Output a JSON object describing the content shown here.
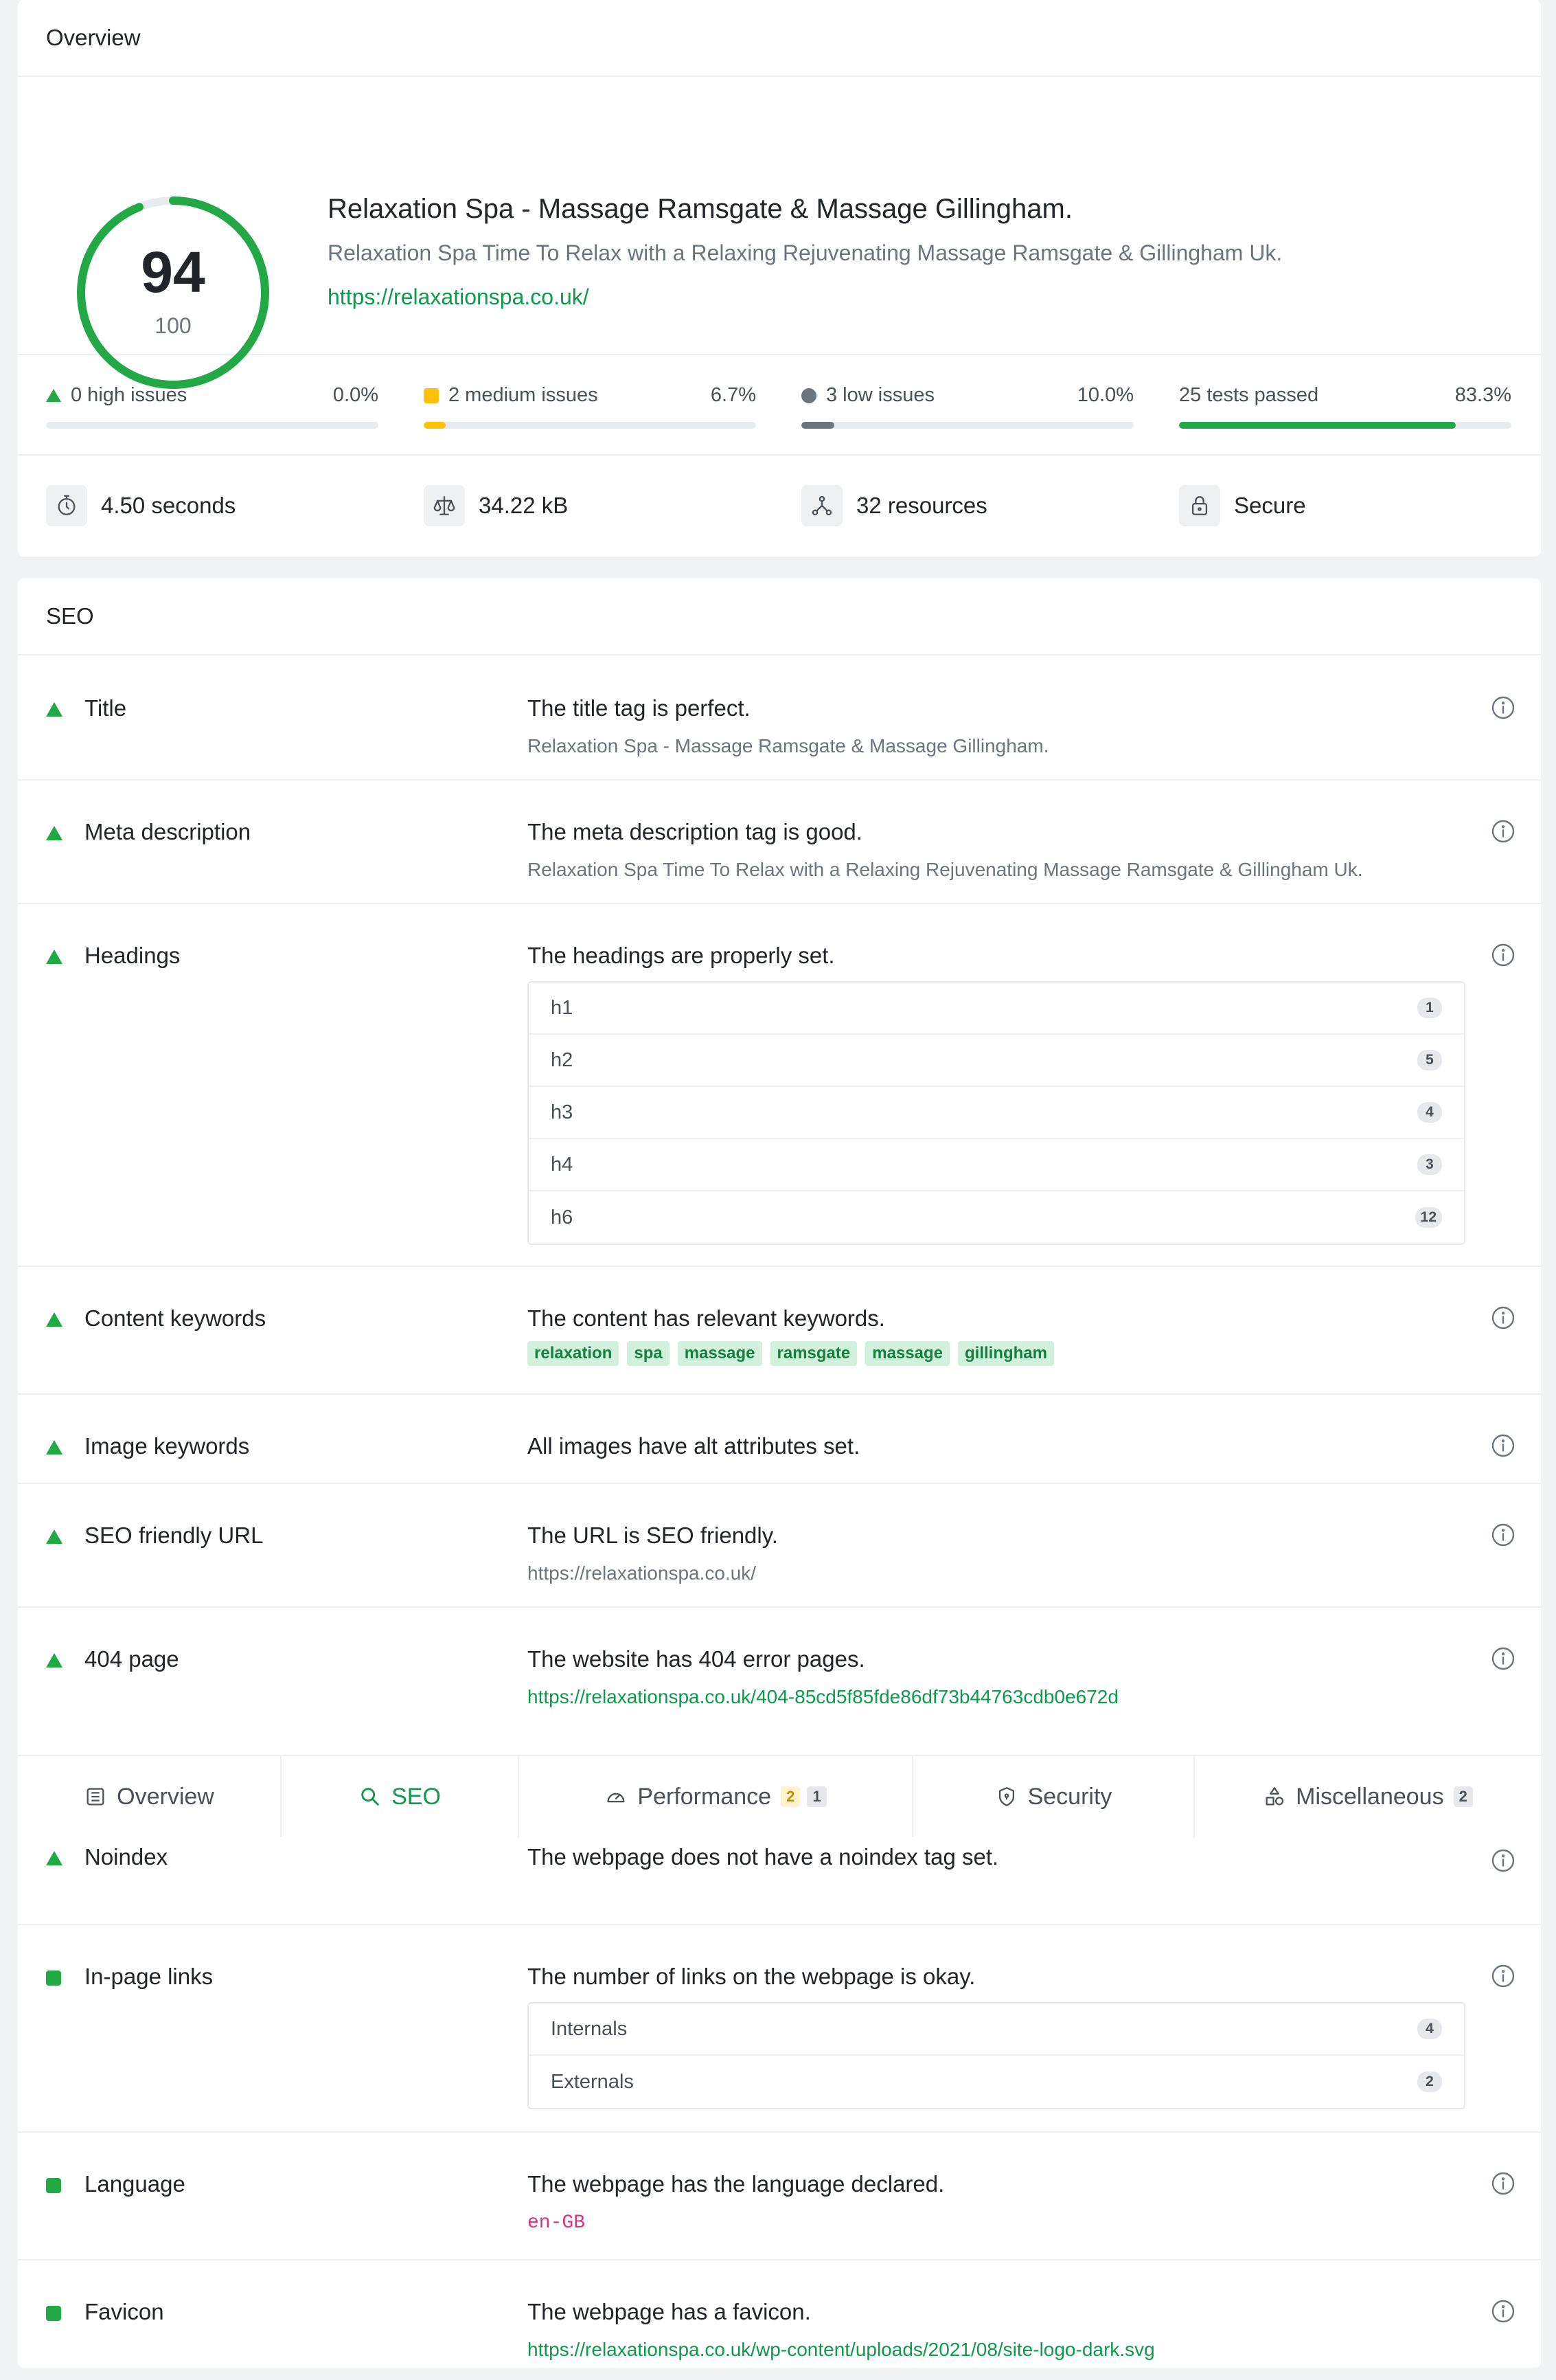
{
  "overview": {
    "header": "Overview",
    "score": "94",
    "score_total": "100",
    "score_fraction": 0.94,
    "site_title": "Relaxation Spa - Massage Ramsgate & Massage Gillingham.",
    "site_description": "Relaxation Spa Time To Relax with a Relaxing Rejuvenating Massage Ramsgate & Gillingham Uk.",
    "site_url": "https://relaxationspa.co.uk/",
    "issues": [
      {
        "label": "0 high issues",
        "percent": "0.0%",
        "fill": 0.0,
        "color": "#22a845"
      },
      {
        "label": "2 medium issues",
        "percent": "6.7%",
        "fill": 0.067,
        "color": "#ffc107"
      },
      {
        "label": "3 low issues",
        "percent": "10.0%",
        "fill": 0.1,
        "color": "#6c757d"
      },
      {
        "label": "25 tests passed",
        "percent": "83.3%",
        "fill": 0.833,
        "color": "#22a845"
      }
    ],
    "stats": [
      {
        "icon": "stopwatch-icon",
        "text": "4.50 seconds"
      },
      {
        "icon": "scale-icon",
        "text": "34.22 kB"
      },
      {
        "icon": "resources-icon",
        "text": "32 resources"
      },
      {
        "icon": "lock-icon",
        "text": "Secure"
      }
    ]
  },
  "seo": {
    "header": "SEO",
    "title": {
      "name": "Title",
      "message": "The title tag is perfect.",
      "detail": "Relaxation Spa - Massage Ramsgate & Massage Gillingham."
    },
    "meta": {
      "name": "Meta description",
      "message": "The meta description tag is good.",
      "detail": "Relaxation Spa Time To Relax with a Relaxing Rejuvenating Massage Ramsgate & Gillingham Uk."
    },
    "headings": {
      "name": "Headings",
      "message": "The headings are properly set.",
      "rows": [
        {
          "label": "h1",
          "count": "1"
        },
        {
          "label": "h2",
          "count": "5"
        },
        {
          "label": "h3",
          "count": "4"
        },
        {
          "label": "h4",
          "count": "3"
        },
        {
          "label": "h6",
          "count": "12"
        }
      ]
    },
    "content_keywords": {
      "name": "Content keywords",
      "message": "The content has relevant keywords.",
      "keywords": [
        "relaxation",
        "spa",
        "massage",
        "ramsgate",
        "massage",
        "gillingham"
      ]
    },
    "image_keywords": {
      "name": "Image keywords",
      "message": "All images have alt attributes set."
    },
    "seo_url": {
      "name": "SEO friendly URL",
      "message": "The URL is SEO friendly.",
      "detail": "https://relaxationspa.co.uk/"
    },
    "page404": {
      "name": "404 page",
      "message": "The website has 404 error pages.",
      "link": "https://relaxationspa.co.uk/404-85cd5f85fde86df73b44763cdb0e672d"
    },
    "noindex": {
      "name": "Noindex",
      "message": "The webpage does not have a noindex tag set."
    },
    "inpage_links": {
      "name": "In-page links",
      "message": "The number of links on the webpage is okay.",
      "rows": [
        {
          "label": "Internals",
          "count": "4"
        },
        {
          "label": "Externals",
          "count": "2"
        }
      ]
    },
    "language": {
      "name": "Language",
      "message": "The webpage has the language declared.",
      "code": "en-GB"
    },
    "favicon": {
      "name": "Favicon",
      "message": "The webpage has a favicon.",
      "link": "https://relaxationspa.co.uk/wp-content/uploads/2021/08/site-logo-dark.svg"
    }
  },
  "tabs": {
    "overview": "Overview",
    "seo": "SEO",
    "performance": "Performance",
    "performance_badge_a": "2",
    "performance_badge_b": "1",
    "security": "Security",
    "misc": "Miscellaneous",
    "misc_badge": "2"
  },
  "colors": {
    "accent": "#0d9a4c",
    "pass": "#22a845",
    "medium": "#ffc107",
    "low": "#6c757d",
    "code": "#d63384"
  }
}
